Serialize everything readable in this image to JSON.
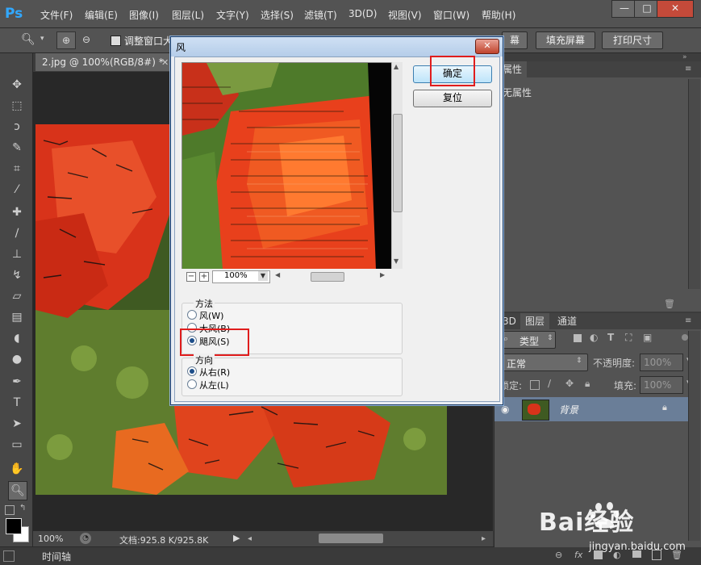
{
  "app": {
    "logo": "Ps",
    "colors": {
      "accent": "#31a8ff",
      "chrome": "#535353",
      "highlight_box": "#e01d1d"
    }
  },
  "menubar": {
    "items": [
      "文件(F)",
      "编辑(E)",
      "图像(I)",
      "图层(L)",
      "文字(Y)",
      "选择(S)",
      "滤镜(T)",
      "3D(D)",
      "视图(V)",
      "窗口(W)",
      "帮助(H)"
    ],
    "window_controls": [
      "—",
      "□",
      "✕"
    ]
  },
  "options_bar": {
    "resize_windows_label": "调整窗口大",
    "fit_button": "幕",
    "fill_screen_button": "填充屏幕",
    "print_size_button": "打印尺寸"
  },
  "document": {
    "tab_title": "2.jpg @ 100%(RGB/8#) *",
    "zoom": "100%",
    "doc_size": "文档:925.8 K/925.8K"
  },
  "timeline": {
    "label": "时间轴"
  },
  "properties_panel": {
    "tab": "属性",
    "content": "无属性"
  },
  "layers_panel": {
    "tabs": [
      "3D",
      "图层",
      "通道"
    ],
    "filter_kind": "类型",
    "blend_mode": "正常",
    "opacity_label": "不透明度:",
    "opacity_value": "100%",
    "lock_label": "锁定:",
    "fill_label": "填充:",
    "fill_value": "100%",
    "layer_name": "背景"
  },
  "dialog": {
    "title": "风",
    "close": "✕",
    "ok_button": "确定",
    "reset_button": "复位",
    "zoom_value": "100%",
    "zoom_minus": "−",
    "zoom_plus": "+",
    "method_group": {
      "title": "方法",
      "options": [
        "风(W)",
        "大风(B)",
        "飓风(S)"
      ],
      "selected": 2
    },
    "direction_group": {
      "title": "方向",
      "options": [
        "从右(R)",
        "从左(L)"
      ],
      "selected": 0
    }
  },
  "watermark": {
    "text": "Bai经验",
    "url": "jingyan.baidu.com"
  }
}
